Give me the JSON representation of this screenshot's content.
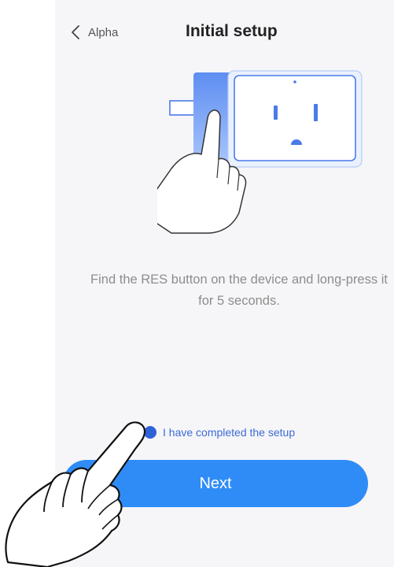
{
  "header": {
    "back_label": "Alpha",
    "title": "Initial setup"
  },
  "instruction": "Find the RES button on the device and long-press it for 5 seconds.",
  "confirm": {
    "label": "I have completed the setup",
    "checked": true
  },
  "next_button": {
    "label": "Next"
  },
  "colors": {
    "accent": "#2f8cf7",
    "link": "#3d6ad6",
    "radio": "#2f62d8",
    "screen_background": "#f6f6f8"
  },
  "icons": {
    "back": "chevron-left-icon",
    "illustration": "smart-plug-press-illustration",
    "pointer": "hand-pointer-icon"
  }
}
